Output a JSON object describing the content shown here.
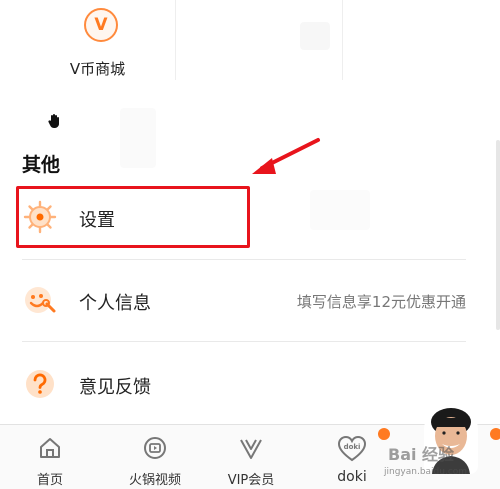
{
  "vcoin_store": {
    "icon_letter": "V",
    "label": "V币商城"
  },
  "section": {
    "title": "其他"
  },
  "menu": [
    {
      "label": "设置",
      "extra": ""
    },
    {
      "label": "个人信息",
      "extra": "填写信息享12元优惠开通"
    },
    {
      "label": "意见反馈",
      "extra": ""
    }
  ],
  "bottom_nav": [
    {
      "label": "首页",
      "icon": "home-icon"
    },
    {
      "label": "火锅视频",
      "icon": "video-icon"
    },
    {
      "label": "VIP会员",
      "icon": "vip-icon"
    },
    {
      "label": "doki",
      "icon": "doki-heart-icon",
      "icon_text": "doki"
    }
  ],
  "watermark": {
    "text": "Bai 经验",
    "sub": "jingyan.baidu.com"
  },
  "colors": {
    "accent": "#ff7a21",
    "highlight": "#e8141c"
  }
}
